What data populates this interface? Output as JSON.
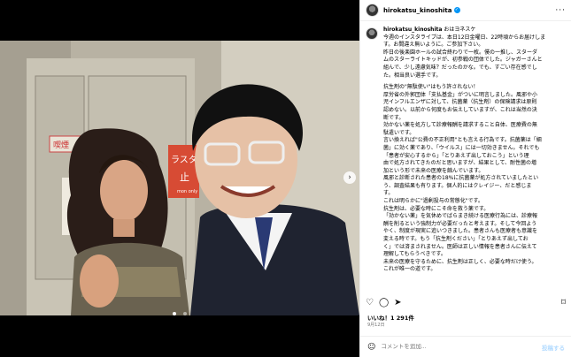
{
  "post": {
    "username": "hirokatsu_kinoshita",
    "more_icon": "more-horizontal-icon",
    "verified_icon": "verified-badge-icon"
  },
  "caption": {
    "username": "hirokatsu_kinoshita",
    "greeting": "おはヨネスケ",
    "lines": [
      "今週のインスタライブは、本日12日金曜日、22時頃からお届けしま",
      "す。お間違え無いように。ご参加下さい。",
      "昨日の後楽園ホールの試合終わりで一枚。僕の一推し、スターダ",
      "ムのスターライトキッドが、初参戦の団体でした。ジャガーさんと",
      "組んで、少し遠慮気味？だったのかな。でも、すごい存在感でし",
      "た。相当良い選手です。",
      "",
      "抗生剤の\"無駄使い\"はもう許されない！",
      "厚労省の外郭団体「支払基金」がついに明言しました。風邪や小",
      "児インフルエンザに対して、抗菌薬（抗生剤）の保険請求は原則",
      "認めない。以前から何度もお伝えしていますが、これは当然の決",
      "断です。",
      "効かない薬を処方して診療報酬を請求すること自体、医療費の無",
      "駄遣いです。",
      "言い換えれば\"公費の不正利用\"とも言える行為です。抗菌薬は「細",
      "菌」に効く薬であり、「ウイルス」には一切効きません。それでも",
      "「患者が安心するから」「とりあえず出しておこう」という理",
      "由で処方されてきたのだと思いますが、結果として、耐性菌の増",
      "加という形で未来の医療を蝕んでいます。",
      "風邪と診断された患者の18%に抗菌薬が処方されていましたとい",
      "う、調査結果も有ります。個人的にはクレイジー、だと感じま",
      "す。",
      "これは明らかに\"過剰投与の常態化\"です。",
      "抗生剤は、必要な時にこそ命を救う薬です。",
      "「効かない薬」を気休めでばらまき続ける医療行為には、診療報",
      "酬を削るという強制力が必要だったと考えます。そして今回よう",
      "やく、制度が現実に追いつきました。患者さんも医療者も意識を",
      "変える時です。もう「抗生剤ください」「とりあえず出してお",
      "く」では済まされません。医師は正しい情報を患者さんに伝えて",
      "理解してもらうべきです。",
      "未来の医療を守るために、抗生剤は正しく、必要な時だけ使う。",
      "これが唯一の道です。"
    ]
  },
  "actions": {
    "like_icon": "heart-icon",
    "comment_icon": "comment-icon",
    "share_icon": "share-icon",
    "save_icon": "bookmark-icon"
  },
  "likes_text": "いいね！1 291件",
  "date_text": "9月12日",
  "comment": {
    "placeholder": "コメントを追加...",
    "post_label": "投稿する"
  },
  "photo": {
    "sign_left": "喫煙",
    "sign_center_1": "ラスタ",
    "sign_center_2": "止",
    "sign_small": "mon only"
  }
}
